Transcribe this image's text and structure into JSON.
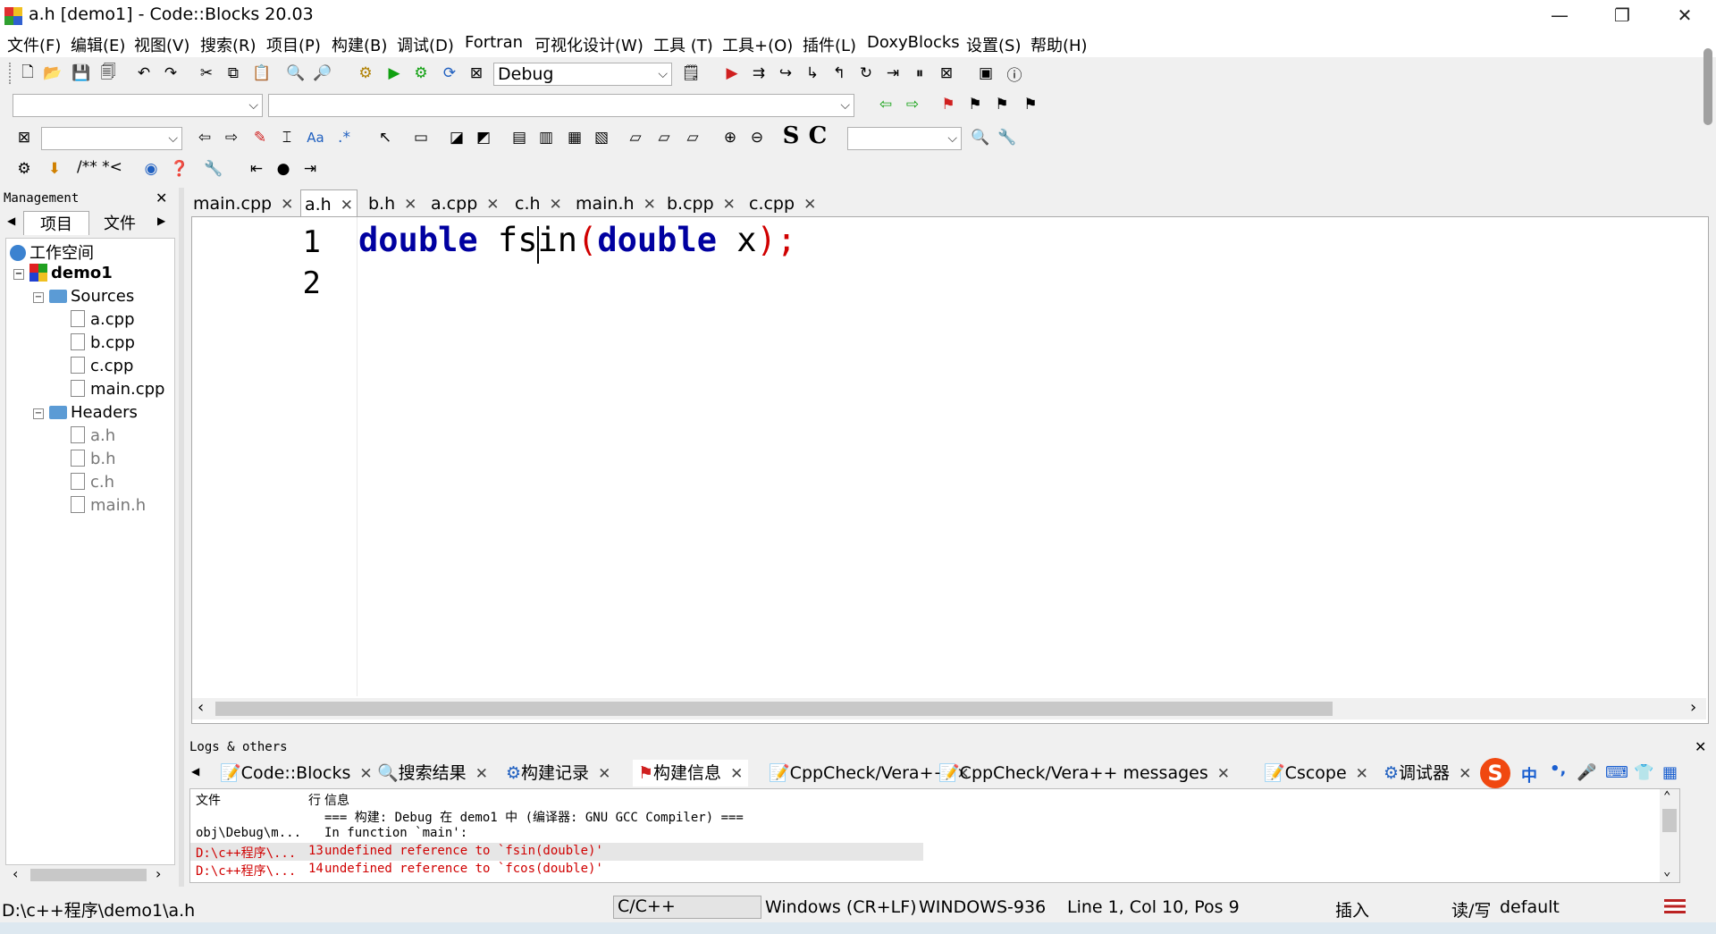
{
  "window": {
    "title": "a.h [demo1] - Code::Blocks 20.03",
    "minimize": "—",
    "restore": "❐",
    "close": "✕"
  },
  "menu": [
    "文件(F)",
    "编辑(E)",
    "视图(V)",
    "搜索(R)",
    "项目(P)",
    "构建(B)",
    "调试(D)",
    "Fortran",
    "可视化设计(W)",
    "工具 (T)",
    "工具+(O)",
    "插件(L)",
    "DoxyBlocks",
    "设置(S)",
    "帮助(H)"
  ],
  "toolbar": {
    "build_target": "Debug",
    "doxy_comment": "/** *<",
    "symbol_s": "S",
    "symbol_c": "C"
  },
  "management": {
    "header": "Management",
    "tabs": [
      "项目",
      "文件"
    ],
    "workspace": "工作空间",
    "project": "demo1",
    "sources_folder": "Sources",
    "sources": [
      "a.cpp",
      "b.cpp",
      "c.cpp",
      "main.cpp"
    ],
    "headers_folder": "Headers",
    "headers": [
      "a.h",
      "b.h",
      "c.h",
      "main.h"
    ]
  },
  "editor": {
    "tabs": [
      "main.cpp",
      "a.h",
      "b.h",
      "a.cpp",
      "c.h",
      "main.h",
      "b.cpp",
      "c.cpp"
    ],
    "active_tab": "a.h",
    "line_numbers": [
      "1",
      "2"
    ],
    "code_line1": {
      "kw1": "double",
      "ident": " fsin",
      "open": "(",
      "kw2": "double",
      "param": " x",
      "close": ");"
    }
  },
  "logs": {
    "header": "Logs & others",
    "tabs": [
      "Code::Blocks",
      "搜索结果",
      "构建记录",
      "构建信息",
      "CppCheck/Vera++",
      "CppCheck/Vera++ messages",
      "Cscope",
      "调试器"
    ],
    "columns": [
      "文件",
      "行",
      "信息"
    ],
    "rows": [
      {
        "file": "",
        "line": "",
        "msg": "=== 构建: Debug 在 demo1 中 (编译器: GNU GCC Compiler) ==="
      },
      {
        "file": "obj\\Debug\\m...",
        "line": "",
        "msg": "In function `main':"
      },
      {
        "file": "D:\\c++程序\\...",
        "line": "13",
        "msg": "undefined reference to `fsin(double)'"
      },
      {
        "file": "D:\\c++程序\\...",
        "line": "14",
        "msg": "undefined reference to `fcos(double)'"
      }
    ],
    "ime": {
      "cn": "中",
      "punct": "•,"
    }
  },
  "status": {
    "path": "D:\\c++程序\\demo1\\a.h",
    "language": "C/C++",
    "eol": "Windows (CR+LF)",
    "encoding": "WINDOWS-936",
    "position": "Line 1, Col 10, Pos 9",
    "mode": "插入",
    "rw": "读/写",
    "profile": "default"
  },
  "colors": {
    "keyword": "#0000a0",
    "punct": "#d00000",
    "error": "#d00000"
  }
}
